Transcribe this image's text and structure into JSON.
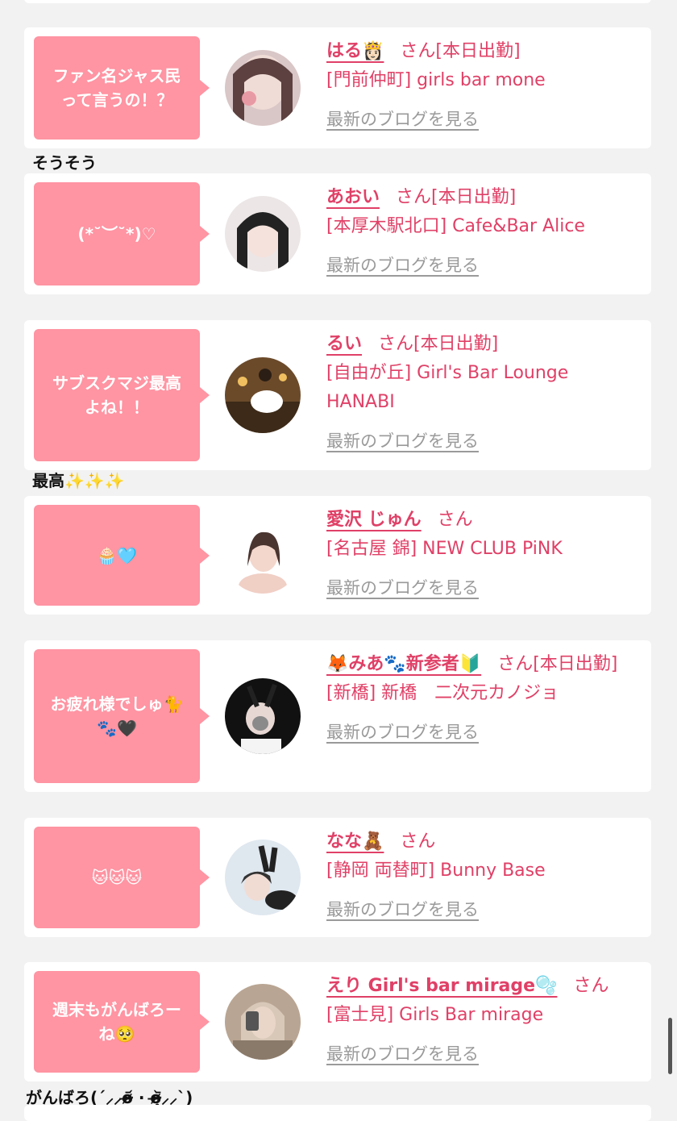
{
  "colors": {
    "accent": "#e04067",
    "bubble": "#ff94a2",
    "link_gray": "#9a9a9a",
    "background": "#f2f2f2"
  },
  "entries": [
    {
      "message": "ファン名ジャス民\nって言うの！？",
      "name": "はる👸🏻",
      "suffix": "さん[本日出勤]",
      "shop": "[門前仲町] girls bar mone",
      "blog_link": "最新のブログを見る",
      "reply": "そうそう"
    },
    {
      "message": "(*˘︶˘*)♡",
      "name": "あおい",
      "suffix": "さん[本日出勤]",
      "shop": "[本厚木駅北口] Cafe&Bar Alice",
      "blog_link": "最新のブログを見る",
      "reply": ""
    },
    {
      "message": "サブスクマジ最高\nよね！！",
      "name": "るい",
      "suffix": "さん[本日出勤]",
      "shop": "[自由が丘] Girl's Bar Lounge HANABI",
      "blog_link": "最新のブログを見る",
      "reply": "最高✨✨✨"
    },
    {
      "message": "🧁🩵",
      "name": "愛沢 じゅん",
      "suffix": "さん",
      "shop": "[名古屋 錦] NEW CLUB PiNK",
      "blog_link": "最新のブログを見る",
      "reply": ""
    },
    {
      "message": "お疲れ様でしゅ🐈\n🐾🖤",
      "name": "🦊みあ🐾新参者🔰",
      "suffix": "さん[本日出勤]",
      "shop": "[新橋] 新橋　二次元カノジョ",
      "blog_link": "最新のブログを見る",
      "reply": ""
    },
    {
      "message": "🐱🐱🐱",
      "name": "なな🧸",
      "suffix": "さん",
      "shop": "[静岡 両替町] Bunny Base",
      "blog_link": "最新のブログを見る",
      "reply": ""
    },
    {
      "message": "週末もがんばろー\nね🥺",
      "name": "えり Girl's bar mirage🫧",
      "suffix": "さん",
      "shop": "[富士見] Girls Bar mirage",
      "blog_link": "最新のブログを見る",
      "reply": "がんばろ(ˊ⸝⸝o̴̶̷᷄ ·̫ o̴̶̷̥᷅⸝⸝ˋ)"
    }
  ]
}
